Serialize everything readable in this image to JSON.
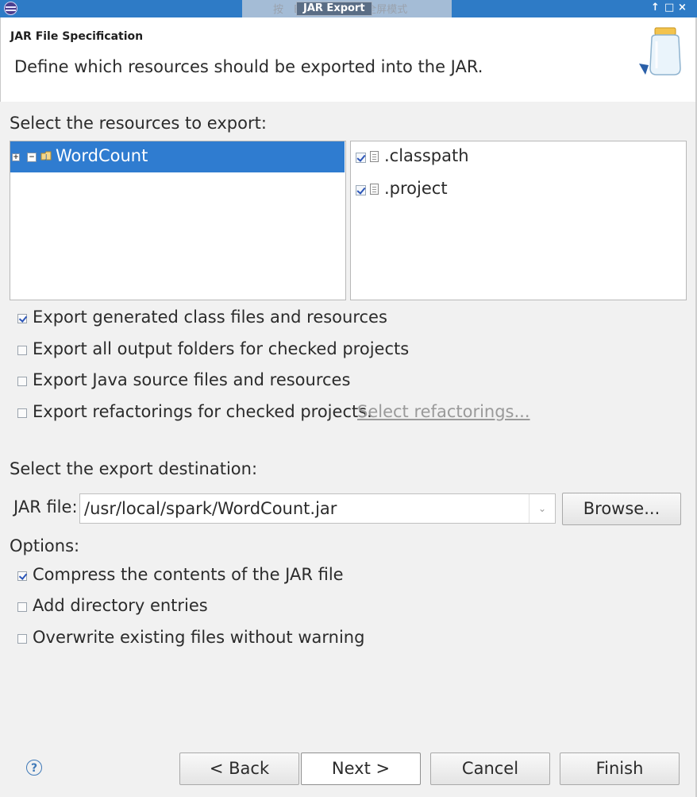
{
  "window": {
    "title": "JAR Export",
    "ime_overlay_text": "按　Esc 键可以退出全屏模式",
    "controls": [
      "↑",
      "□",
      "×"
    ]
  },
  "header": {
    "title": "JAR File Specification",
    "description": "Define which resources should be exported into the JAR."
  },
  "resources": {
    "label": "Select the resources to export:",
    "tree": [
      {
        "label": "WordCount",
        "selected": true,
        "checked": "partial"
      }
    ],
    "files": [
      {
        "label": ".classpath",
        "checked": true
      },
      {
        "label": ".project",
        "checked": true
      }
    ]
  },
  "export_options": [
    {
      "label": "Export generated class files and resources",
      "checked": true
    },
    {
      "label": "Export all output folders for checked projects",
      "checked": false
    },
    {
      "label": "Export Java source files and resources",
      "checked": false
    },
    {
      "label": "Export refactorings for checked projects.",
      "checked": false,
      "link": "Select refactorings..."
    }
  ],
  "destination": {
    "label": "Select the export destination:",
    "jar_label": "JAR file:",
    "jar_value": "/usr/local/spark/WordCount.jar",
    "browse": "Browse..."
  },
  "options": {
    "label": "Options:",
    "items": [
      {
        "label": "Compress the contents of the JAR file",
        "checked": true
      },
      {
        "label": "Add directory entries",
        "checked": false
      },
      {
        "label": "Overwrite existing files without warning",
        "checked": false
      }
    ]
  },
  "footer": {
    "help": "?",
    "back": "< Back",
    "next": "Next >",
    "cancel": "Cancel",
    "finish": "Finish"
  },
  "colors": {
    "titlebar": "#2e7bc6",
    "selection": "#2f7cd0",
    "link": "#9a9a9a",
    "checkmark": "#2b55b8"
  }
}
